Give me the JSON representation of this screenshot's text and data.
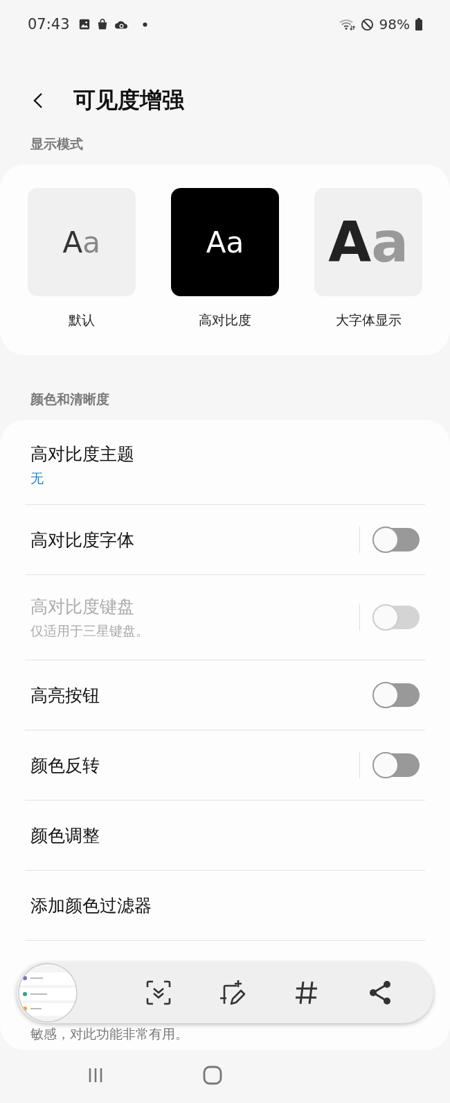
{
  "status_bar": {
    "time": "07:43",
    "battery": "98%"
  },
  "header": {
    "title": "可见度增强"
  },
  "display_mode": {
    "label": "显示模式",
    "modes": [
      {
        "kind": "default",
        "preview": "Aa",
        "label": "默认"
      },
      {
        "kind": "high_contrast",
        "preview": "Aa",
        "label": "高对比度"
      },
      {
        "kind": "large",
        "preview": "Aa",
        "label": "大字体显示"
      }
    ]
  },
  "color_section": {
    "label": "颜色和清晰度",
    "rows": [
      {
        "kind": "link",
        "title": "高对比度主题",
        "value": "无"
      },
      {
        "kind": "toggle",
        "title": "高对比度字体",
        "on": false,
        "disabled": false,
        "divider": true
      },
      {
        "kind": "toggle",
        "title": "高对比度键盘",
        "subtitle": "仅适用于三星键盘。",
        "on": false,
        "disabled": true,
        "divider": true
      },
      {
        "kind": "toggle",
        "title": "高亮按钮",
        "on": false,
        "disabled": false,
        "divider": false
      },
      {
        "kind": "toggle",
        "title": "颜色反转",
        "on": false,
        "disabled": false,
        "divider": true
      },
      {
        "kind": "link",
        "title": "颜色调整"
      },
      {
        "kind": "link",
        "title": "添加颜色过滤器"
      }
    ],
    "partial_text": "敏感，对此功能非常有用。"
  }
}
